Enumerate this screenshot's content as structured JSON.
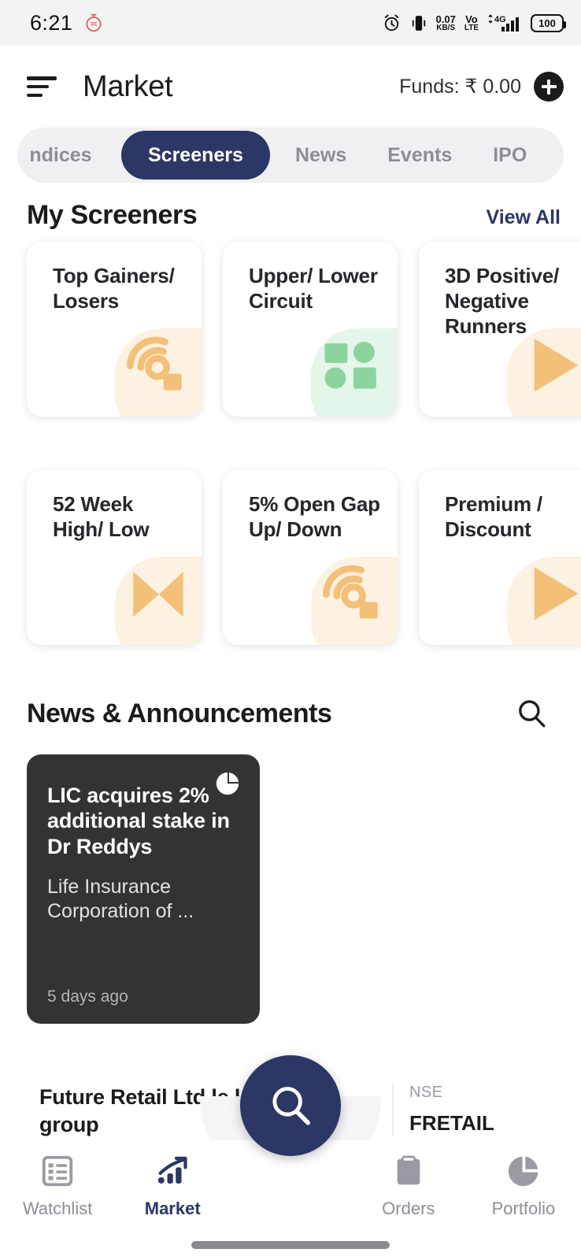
{
  "statusbar": {
    "time": "6:21",
    "alarm_icon": "alarm-clock-icon",
    "vibrate_icon": "vibrate-icon",
    "net_speed_value": "0.07",
    "net_speed_unit": "KB/S",
    "volte_line1": "Vo",
    "volte_line2": "LTE",
    "network_type": "4G",
    "battery_level": "100"
  },
  "header": {
    "menu_icon": "hamburger-menu-icon",
    "title": "Market",
    "funds_label": "Funds: ₹ 0.00",
    "add_funds_icon": "plus-icon"
  },
  "tabs": [
    {
      "label": "ndices",
      "active": false
    },
    {
      "label": "Screeners",
      "active": true
    },
    {
      "label": "News",
      "active": false
    },
    {
      "label": "Events",
      "active": false
    },
    {
      "label": "IPO",
      "active": false
    }
  ],
  "screeners": {
    "section_title": "My Screeners",
    "view_all_label": "View All",
    "cards": [
      {
        "title": "Top Gainers/ Losers",
        "icon": "radar-signal-icon",
        "accent": "#f5c27a",
        "blob": "#fdf1e1"
      },
      {
        "title": "Upper/ Lower Circuit",
        "icon": "grid-shapes-icon",
        "accent": "#8bd49f",
        "blob": "#e4f5e9"
      },
      {
        "title": "3D Positive/ Negative Runners",
        "icon": "play-triangle-icon",
        "accent": "#f5c27a",
        "blob": "#fdf1e1"
      },
      {
        "title": "52 Week High/ Low",
        "icon": "hourglass-bowtie-icon",
        "accent": "#f5c27a",
        "blob": "#fdf1e1"
      },
      {
        "title": "5% Open Gap Up/ Down",
        "icon": "radar-signal-icon",
        "accent": "#f5c27a",
        "blob": "#fdf1e1"
      },
      {
        "title": "Premium / Discount",
        "icon": "play-triangle-icon",
        "accent": "#f5c27a",
        "blob": "#fdf1e1"
      }
    ]
  },
  "news": {
    "section_title": "News & Announcements",
    "search_icon": "search-icon",
    "featured": {
      "icon": "pie-chart-icon",
      "headline": "LIC acquires 2% additional stake in Dr Reddys",
      "body": "Life Insurance Corporation of ...",
      "timestamp": "5 days ago"
    },
    "second": {
      "headline": "Future Retail Ltd le losers in A group",
      "exchange": "NSE",
      "ticker": "FRETAIL"
    }
  },
  "fab": {
    "icon": "search-icon"
  },
  "bottomnav": [
    {
      "label": "Watchlist",
      "icon": "list-icon",
      "active": false
    },
    {
      "label": "Market",
      "icon": "bar-chart-arrow-icon",
      "active": true
    },
    {
      "label": "Orders",
      "icon": "box-icon",
      "active": false
    },
    {
      "label": "Portfolio",
      "icon": "pie-chart-icon",
      "active": false
    }
  ],
  "colors": {
    "brand_navy": "#2b3765",
    "card_dark": "#333333",
    "muted_gray": "#8d8d96",
    "amber": "#f5c27a",
    "green": "#8bd49f"
  }
}
